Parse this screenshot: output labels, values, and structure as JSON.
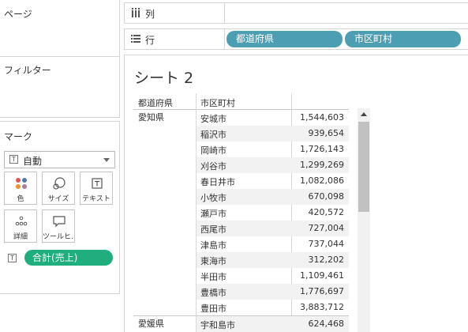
{
  "left_panel": {
    "pages_title": "ページ",
    "filters_title": "フィルター",
    "marks_title": "マーク",
    "mark_type": {
      "icon": "text-mark-icon",
      "label": "自動"
    },
    "mark_buttons": [
      {
        "icon": "color-icon",
        "label": "色"
      },
      {
        "icon": "size-icon",
        "label": "サイズ"
      },
      {
        "icon": "text-icon",
        "label": "テキスト"
      },
      {
        "icon": "detail-icon",
        "label": "詳細"
      },
      {
        "icon": "tooltip-icon",
        "label": "ツールヒ..."
      }
    ],
    "measure_pill": {
      "icon": "text-mark-icon",
      "label": "合計(売上)",
      "color": "#1fae7d"
    }
  },
  "shelves": {
    "columns": {
      "icon": "columns-icon",
      "label": "列"
    },
    "rows": {
      "icon": "rows-icon",
      "label": "行",
      "pills": [
        "都道府県",
        "市区町村"
      ],
      "pill_color": "#4c9fb3"
    }
  },
  "view": {
    "sheet_title": "シート 2",
    "headers": {
      "prefecture": "都道府県",
      "city": "市区町村"
    },
    "groups": [
      {
        "prefecture": "愛知県",
        "rows": [
          {
            "city": "安城市",
            "value": "1,544,603"
          },
          {
            "city": "稲沢市",
            "value": "939,654"
          },
          {
            "city": "岡崎市",
            "value": "1,726,143"
          },
          {
            "city": "刈谷市",
            "value": "1,299,269"
          },
          {
            "city": "春日井市",
            "value": "1,082,086"
          },
          {
            "city": "小牧市",
            "value": "670,098"
          },
          {
            "city": "瀬戸市",
            "value": "420,572"
          },
          {
            "city": "西尾市",
            "value": "727,004"
          },
          {
            "city": "津島市",
            "value": "737,044"
          },
          {
            "city": "東海市",
            "value": "312,202"
          },
          {
            "city": "半田市",
            "value": "1,109,461"
          },
          {
            "city": "豊橋市",
            "value": "1,776,697"
          },
          {
            "city": "豊田市",
            "value": "3,883,712"
          }
        ]
      },
      {
        "prefecture": "愛媛県",
        "rows": [
          {
            "city": "宇和島市",
            "value": "624,468"
          }
        ]
      }
    ]
  }
}
